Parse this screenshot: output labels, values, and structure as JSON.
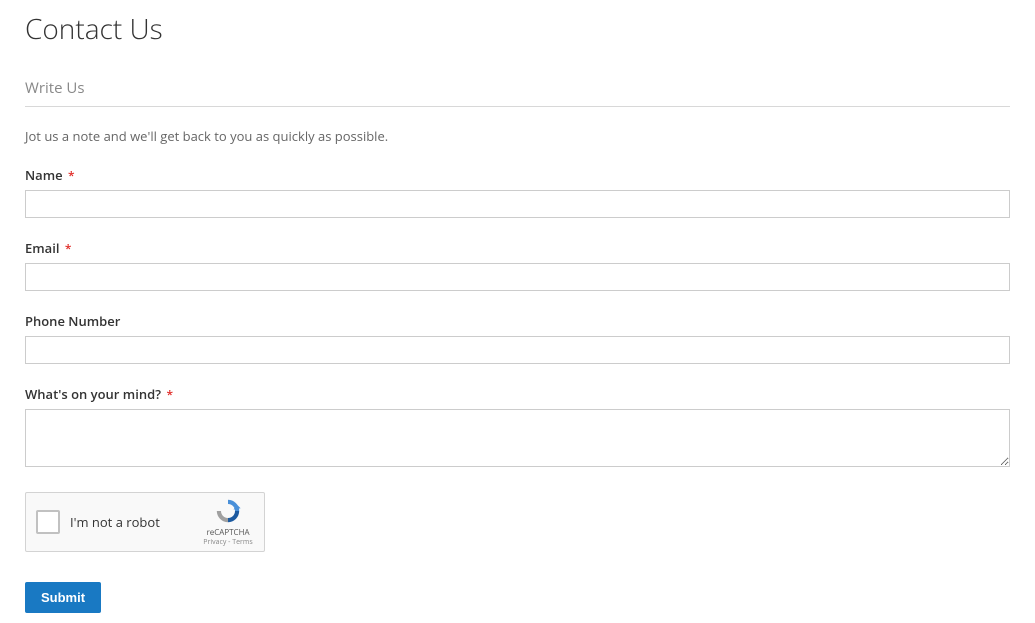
{
  "page": {
    "title": "Contact Us",
    "section_title": "Write Us",
    "intro": "Jot us a note and we'll get back to you as quickly as possible."
  },
  "fields": {
    "name": {
      "label": "Name",
      "required": "*",
      "value": ""
    },
    "email": {
      "label": "Email",
      "required": "*",
      "value": ""
    },
    "phone": {
      "label": "Phone Number",
      "value": ""
    },
    "comment": {
      "label": "What's on your mind?",
      "required": "*",
      "value": ""
    }
  },
  "recaptcha": {
    "label": "I'm not a robot",
    "brand": "reCAPTCHA",
    "links": "Privacy - Terms"
  },
  "actions": {
    "submit": "Submit"
  }
}
